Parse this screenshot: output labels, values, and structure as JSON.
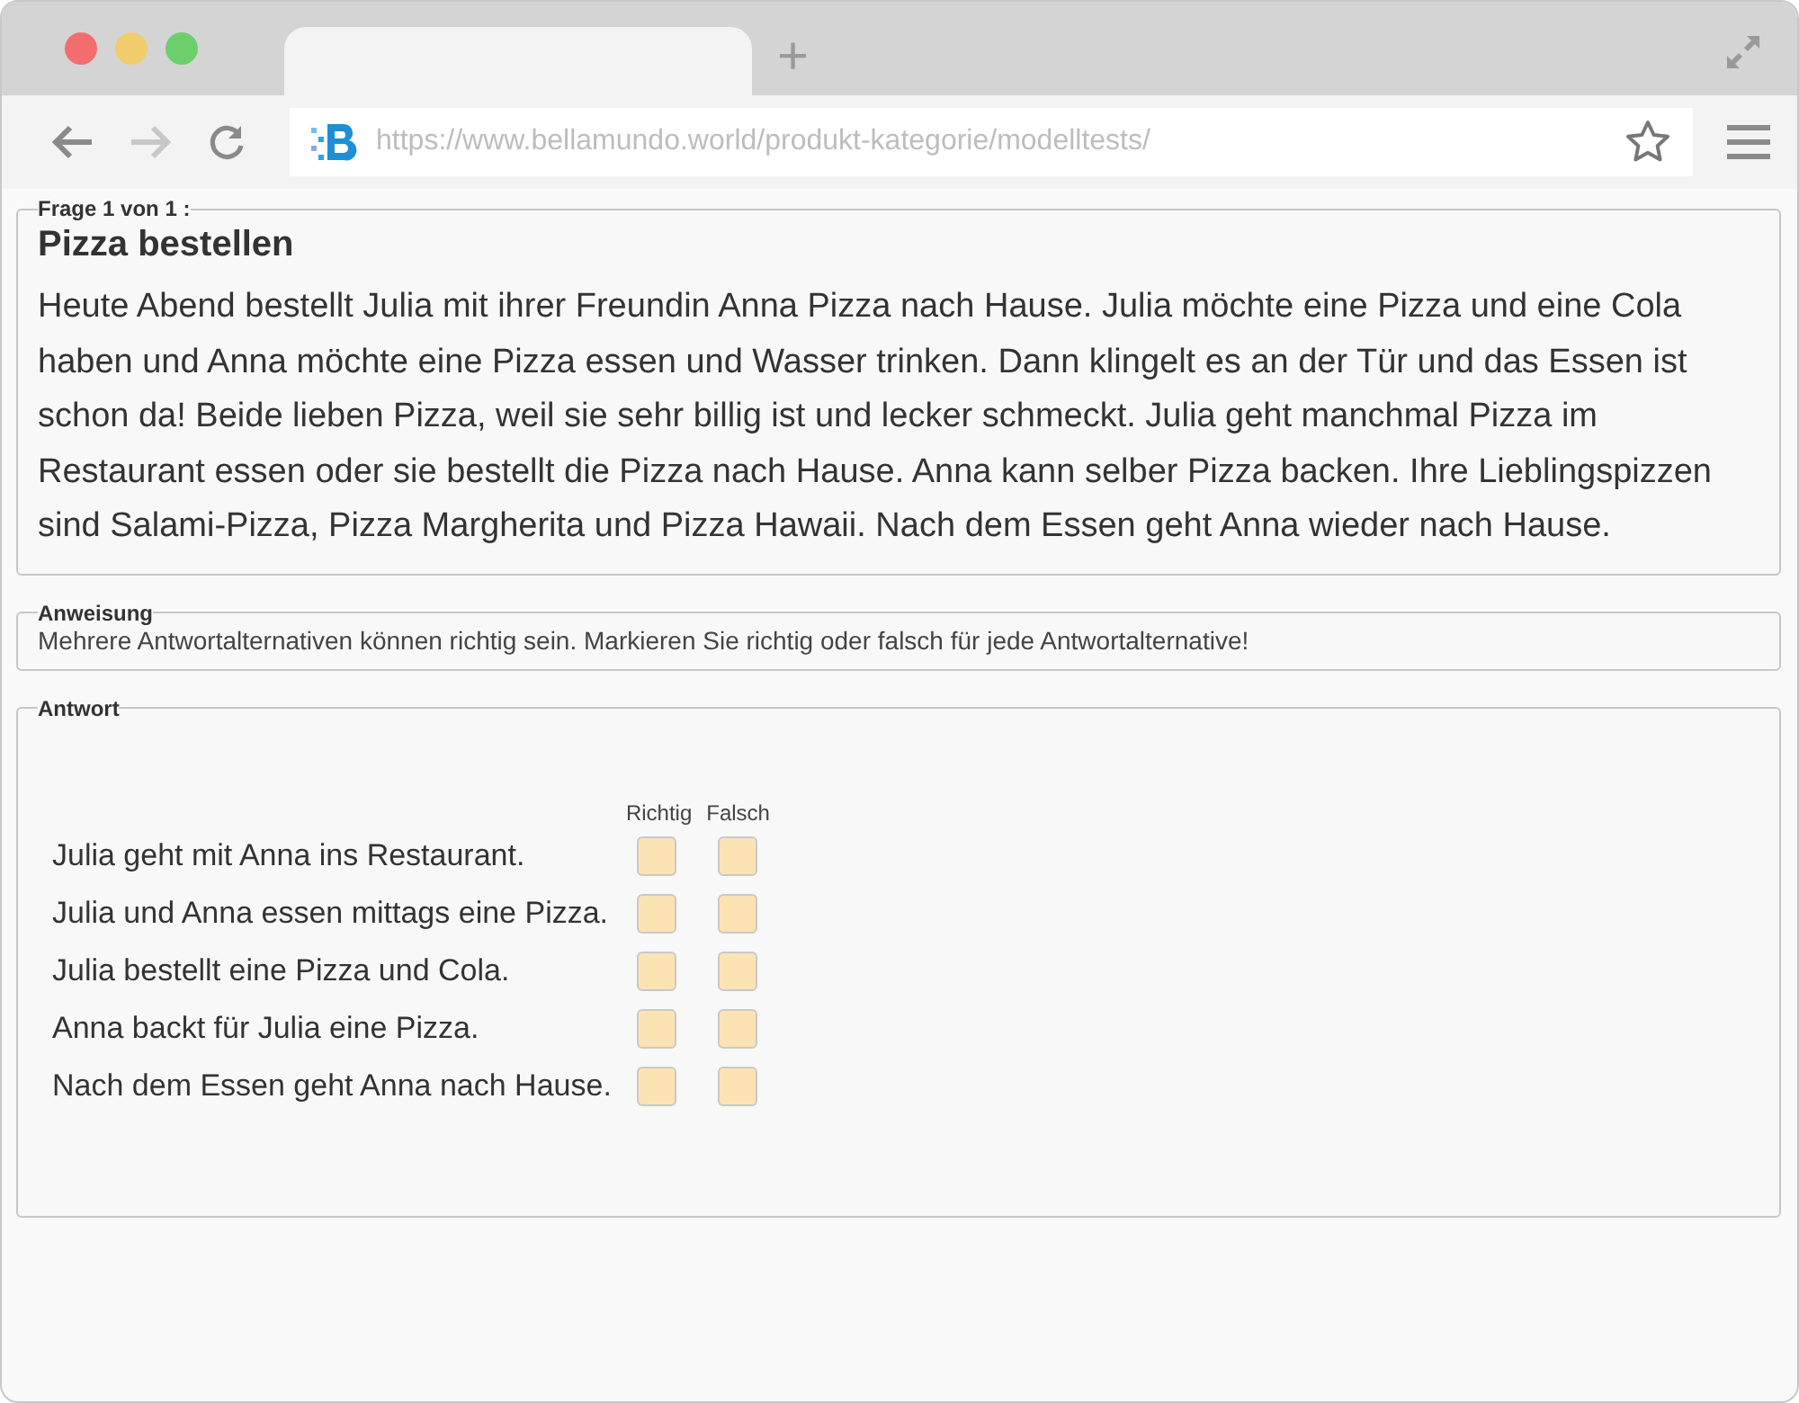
{
  "browser": {
    "tab_new": "+",
    "url": "https://www.bellamundo.world/produkt-kategorie/modelltests/"
  },
  "question": {
    "legend": "Frage 1 von 1 :",
    "title": "Pizza bestellen",
    "text": "Heute Abend bestellt Julia mit ihrer Freundin Anna Pizza nach Hause. Julia möchte eine Pizza und eine Cola haben und Anna möchte eine Pizza essen und Wasser trinken. Dann klingelt es an der Tür und das Essen ist schon da! Beide lieben Pizza, weil sie sehr billig ist und lecker schmeckt. Julia geht manchmal Pizza im Restaurant essen oder sie bestellt die Pizza nach Hause. Anna kann selber Pizza backen. Ihre Lieblingspizzen sind Salami-Pizza, Pizza Margherita und Pizza Hawaii. Nach dem Essen geht Anna wieder nach Hause."
  },
  "instruction": {
    "legend": "Anweisung",
    "text": "Mehrere Antwortalternativen können richtig sein. Markieren Sie richtig oder falsch für jede Antwortalternative!"
  },
  "answer": {
    "legend": "Antwort",
    "columns": [
      "Richtig",
      "Falsch"
    ],
    "rows": [
      {
        "statement": "Julia geht mit Anna ins Restaurant.",
        "richtig": false,
        "falsch": false
      },
      {
        "statement": "Julia und Anna essen mittags eine Pizza.",
        "richtig": false,
        "falsch": false
      },
      {
        "statement": "Julia bestellt eine Pizza und Cola.",
        "richtig": false,
        "falsch": false
      },
      {
        "statement": "Anna backt für Julia eine Pizza.",
        "richtig": false,
        "falsch": false
      },
      {
        "statement": "Nach dem Essen geht Anna nach Hause.",
        "richtig": false,
        "falsch": false
      }
    ]
  }
}
